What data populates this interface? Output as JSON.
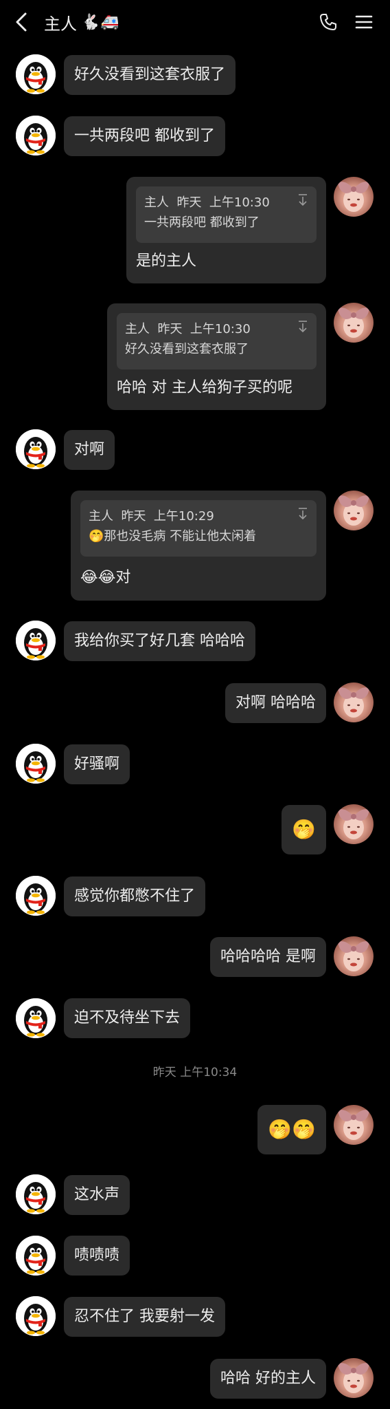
{
  "header": {
    "title": "主人",
    "title_emoji": "🐇🚑"
  },
  "messages": [
    {
      "side": "left",
      "text": "好久没看到这套衣服了"
    },
    {
      "side": "left",
      "text": "一共两段吧 都收到了"
    },
    {
      "side": "right",
      "quote": {
        "author": "主人",
        "day": "昨天",
        "time": "上午10:30",
        "text": "一共两段吧 都收到了"
      },
      "text": "是的主人"
    },
    {
      "side": "right",
      "quote": {
        "author": "主人",
        "day": "昨天",
        "time": "上午10:30",
        "text": "好久没看到这套衣服了"
      },
      "text": "哈哈 对 主人给狗子买的呢"
    },
    {
      "side": "left",
      "text": "对啊"
    },
    {
      "side": "right",
      "quote": {
        "author": "主人",
        "day": "昨天",
        "time": "上午10:29",
        "emoji": "🤭",
        "text": "那也没毛病 不能让他太闲着"
      },
      "emoji": "😂😂",
      "text": "对"
    },
    {
      "side": "left",
      "text": "我给你买了好几套 哈哈哈"
    },
    {
      "side": "right",
      "text": "对啊 哈哈哈"
    },
    {
      "side": "left",
      "text": "好骚啊"
    },
    {
      "side": "right",
      "text": "🤭"
    },
    {
      "side": "left",
      "text": "感觉你都憋不住了"
    },
    {
      "side": "right",
      "text": "哈哈哈哈 是啊"
    },
    {
      "side": "left",
      "text": "迫不及待坐下去"
    },
    {
      "side": "right",
      "text": "🤭🤭"
    },
    {
      "side": "left",
      "text": "这水声"
    },
    {
      "side": "left",
      "text": "啧啧啧"
    },
    {
      "side": "left",
      "text": "忍不住了 我要射一发"
    },
    {
      "side": "right",
      "text": "哈哈 好的主人"
    }
  ],
  "timestamp": "昨天 上午10:34",
  "colors": {
    "background": "#000000",
    "bubble": "#2b2b2b",
    "quote_box": "#3c3c3c",
    "timestamp": "#8a8a8a"
  },
  "icons": {
    "back": "chevron-left-icon",
    "phone": "phone-icon",
    "menu": "menu-icon",
    "collapse": "collapse-arrow-icon",
    "left_avatar": "penguin-avatar",
    "right_avatar": "photo-avatar"
  }
}
